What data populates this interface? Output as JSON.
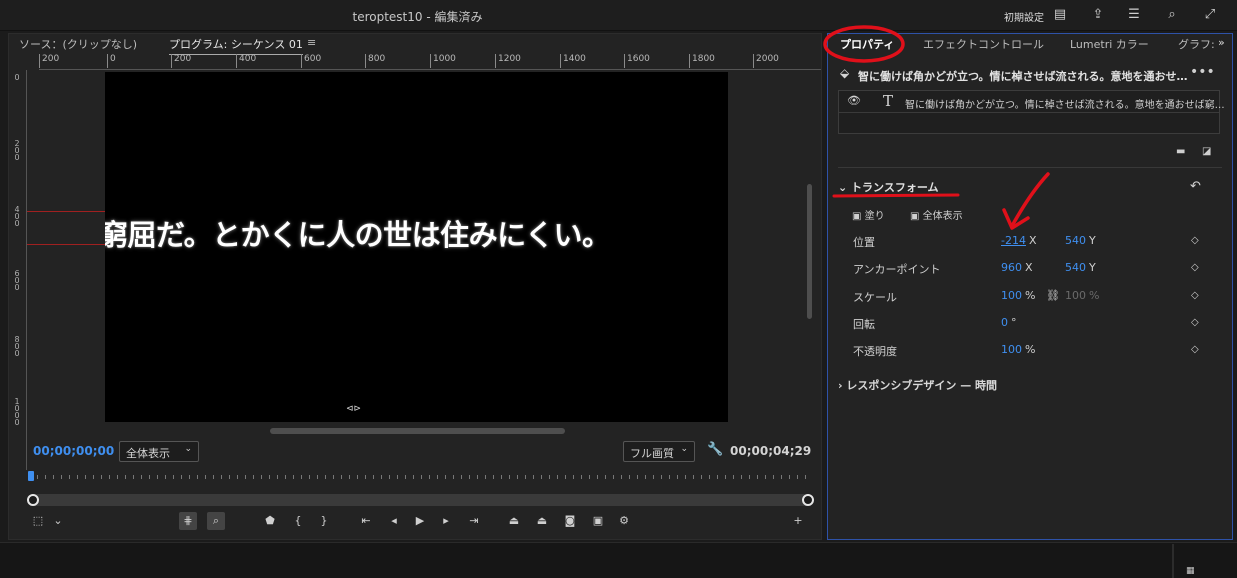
{
  "titlebar": {
    "title": "teroptest10 - 編集済み",
    "workspace_label": "初期設定",
    "icons": [
      "panel-icon",
      "share-icon",
      "settings-menu-icon",
      "search-icon",
      "fullscreen-icon"
    ]
  },
  "program_monitor": {
    "tabs": [
      {
        "label": "ソース：(クリップなし)"
      },
      {
        "label": "プログラム: シーケンス 01"
      }
    ],
    "tab_menu": "≡",
    "ruler_h": [
      "200",
      "0",
      "200",
      "400",
      "600",
      "800",
      "1000",
      "1200",
      "1400",
      "1600",
      "1800",
      "2000"
    ],
    "ruler_v": [
      "0",
      "2\n0\n0",
      "4\n0\n0",
      "6\n0\n0",
      "8\n0\n0",
      "1\n0\n0\n0"
    ],
    "caption": "窮屈だ。とかくに人の世は住みにくい。",
    "timecode_in": "00;00;00;00",
    "zoom_select": "全体表示",
    "quality_select": "フル画質",
    "timecode_out": "00;00;04;29"
  },
  "properties_panel": {
    "tabs": [
      {
        "label": "プロパティ"
      },
      {
        "label": "エフェクトコントロール"
      },
      {
        "label": "Lumetri カラー"
      },
      {
        "label": "グラフ:"
      }
    ],
    "overflow": "»",
    "object_title": "智に働けば角かどが立つ。情に棹させば流される。意地を通おせ…",
    "more": "•••",
    "layer_text": "智に働けば角かどが立つ。情に棹させば流される。意地を通おせば窮…",
    "transform": {
      "section_label": "トランスフォーム",
      "fill_label": "塗り",
      "fullview_label": "全体表示",
      "rows": [
        {
          "label": "位置",
          "v1": "-214",
          "u1": "X",
          "v2": "540",
          "u2": "Y"
        },
        {
          "label": "アンカーポイント",
          "v1": "960",
          "u1": "X",
          "v2": "540",
          "u2": "Y"
        },
        {
          "label": "スケール",
          "v1": "100",
          "u1": "%",
          "v2": "100",
          "u2": "%"
        },
        {
          "label": "回転",
          "v1": "0",
          "u1": "°",
          "v2": "",
          "u2": ""
        },
        {
          "label": "不透明度",
          "v1": "100",
          "u1": "%",
          "v2": "",
          "u2": ""
        }
      ]
    },
    "responsive_label": "レスポンシブデザイン — 時間"
  },
  "colors": {
    "accent": "#3f8ff0",
    "annotation": "#e0101a",
    "panel_border": "#2e52a8"
  }
}
